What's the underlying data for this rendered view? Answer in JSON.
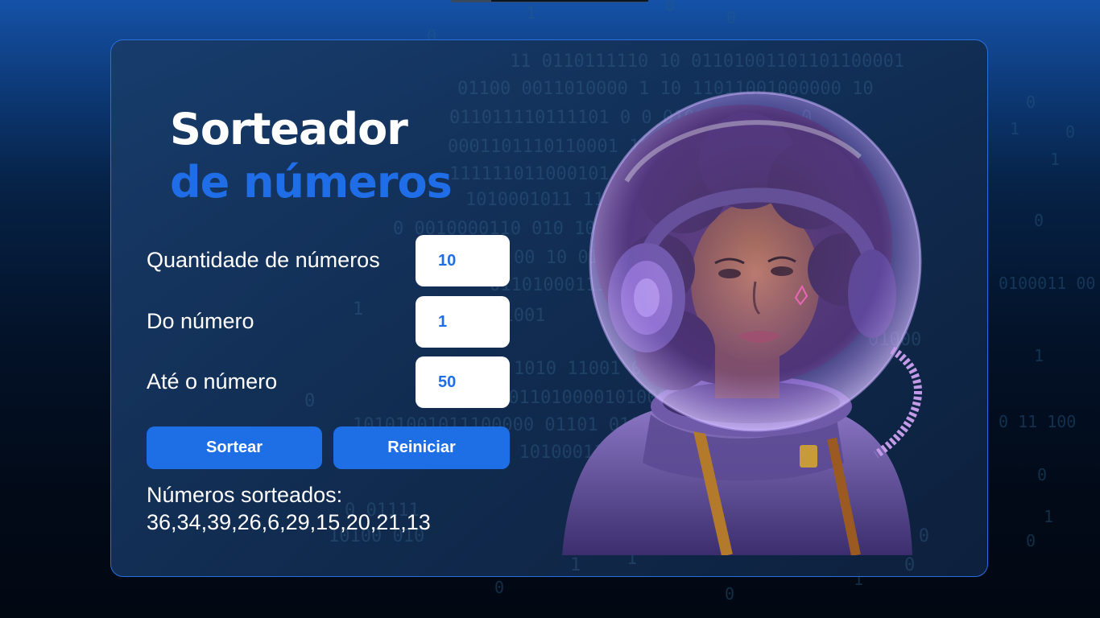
{
  "title": {
    "line1": "Sorteador",
    "line2": "de números"
  },
  "fields": [
    {
      "label": "Quantidade de números",
      "value": "10"
    },
    {
      "label": "Do número",
      "value": "1"
    },
    {
      "label": "Até o número",
      "value": "50"
    }
  ],
  "buttons": {
    "draw": "Sortear",
    "reset": "Reiniciar"
  },
  "result": {
    "label": "Números sorteados:",
    "values": "36,34,39,26,6,29,15,20,21,13"
  },
  "colors": {
    "accent": "#1e6fe6",
    "title_highlight": "#1f6ee8",
    "card_border": "#2a6fe0"
  },
  "illustration": {
    "name": "astronaut-girl-illustration"
  }
}
